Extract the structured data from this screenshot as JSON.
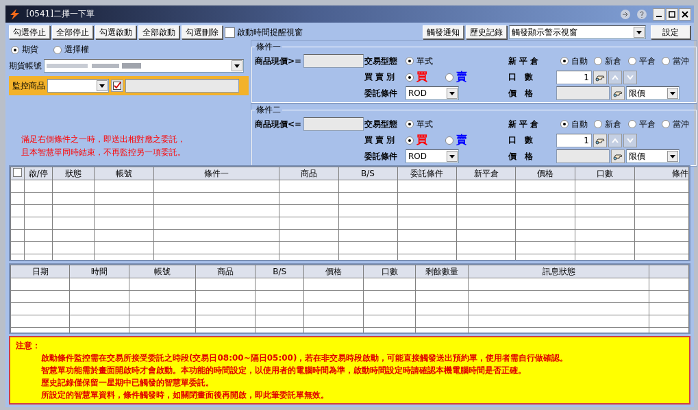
{
  "window": {
    "title": "[0541]二擇一下單"
  },
  "toolbar": {
    "left_buttons": [
      "勾選停止",
      "全部停止",
      "勾選啟動",
      "全部啟動",
      "勾選刪除"
    ],
    "reminder": {
      "label": "啟動時間提醒視窗",
      "checked": false
    },
    "right_buttons": [
      "觸發通知",
      "歷史記錄"
    ],
    "display_select": {
      "value": "觸發顯示警示視窗"
    },
    "settings_button": "設定"
  },
  "market": [
    {
      "label": "期貨",
      "selected": true
    },
    {
      "label": "選擇權",
      "selected": false
    }
  ],
  "account": {
    "label": "期貨帳號"
  },
  "monitor": {
    "label": "監控商品",
    "checked": true
  },
  "note": [
    "滿足右側條件之一時，即送出相對應之委託，",
    "且本智慧單同時結束，不再監控另一項委託。"
  ],
  "conditions": [
    {
      "title": "條件一",
      "price_label": "商品現價>=",
      "trade_type_label": "交易型態",
      "trade_types": [
        {
          "label": "單式",
          "selected": true
        }
      ],
      "open_close_label": "新 平 倉",
      "open_close": [
        {
          "label": "自動",
          "selected": true
        },
        {
          "label": "新倉",
          "selected": false
        },
        {
          "label": "平倉",
          "selected": false
        },
        {
          "label": "當沖",
          "selected": false
        }
      ],
      "side_label": "買 賣 別",
      "sides": [
        {
          "label": "買",
          "selected": true,
          "color": "#ff0000"
        },
        {
          "label": "賣",
          "selected": false,
          "color": "#0000ff"
        }
      ],
      "qty_label": "口　數",
      "qty": "1",
      "order_cond_label": "委託條件",
      "order_cond": "ROD",
      "price_label2": "價　格",
      "price_type": "限價"
    },
    {
      "title": "條件二",
      "price_label": "商品現價<=",
      "trade_type_label": "交易型態",
      "trade_types": [
        {
          "label": "單式",
          "selected": true
        }
      ],
      "open_close_label": "新 平 倉",
      "open_close": [
        {
          "label": "自動",
          "selected": true
        },
        {
          "label": "新倉",
          "selected": false
        },
        {
          "label": "平倉",
          "selected": false
        },
        {
          "label": "當沖",
          "selected": false
        }
      ],
      "side_label": "買 賣 別",
      "sides": [
        {
          "label": "買",
          "selected": true,
          "color": "#ff0000"
        },
        {
          "label": "賣",
          "selected": false,
          "color": "#0000ff"
        }
      ],
      "qty_label": "口　數",
      "qty": "1",
      "order_cond_label": "委託條件",
      "order_cond": "ROD",
      "price_label2": "價　格",
      "price_type": "限價"
    }
  ],
  "orders_table": {
    "select_all_checked": false,
    "columns": [
      "啟/停",
      "狀態",
      "帳號",
      "條件一",
      "商品",
      "B/S",
      "委託條件",
      "新平倉",
      "價格",
      "口數",
      "條件"
    ]
  },
  "history_table": {
    "columns": [
      "日期",
      "時間",
      "帳號",
      "商品",
      "B/S",
      "價格",
      "口數",
      "剩餘數量",
      "訊息狀態"
    ]
  },
  "notice": {
    "title": "注意：",
    "lines": [
      "啟動條件監控需在交易所接受委託之時段(交易日08:00~隔日05:00)，若在非交易時段啟動，可能直接觸發送出預約單，使用者需自行做確認。",
      "智慧單功能需於畫面開啟時才會啟動。本功能的時間設定，以使用者的電腦時間為準，啟動時間設定時請確認本機電腦時間是否正確。",
      "歷史記錄僅保留一星期中已觸發的智慧單委託。",
      "所設定的智慧單資料，條件觸發時，如關閉畫面後再開啟，即此筆委託單無效。"
    ]
  }
}
